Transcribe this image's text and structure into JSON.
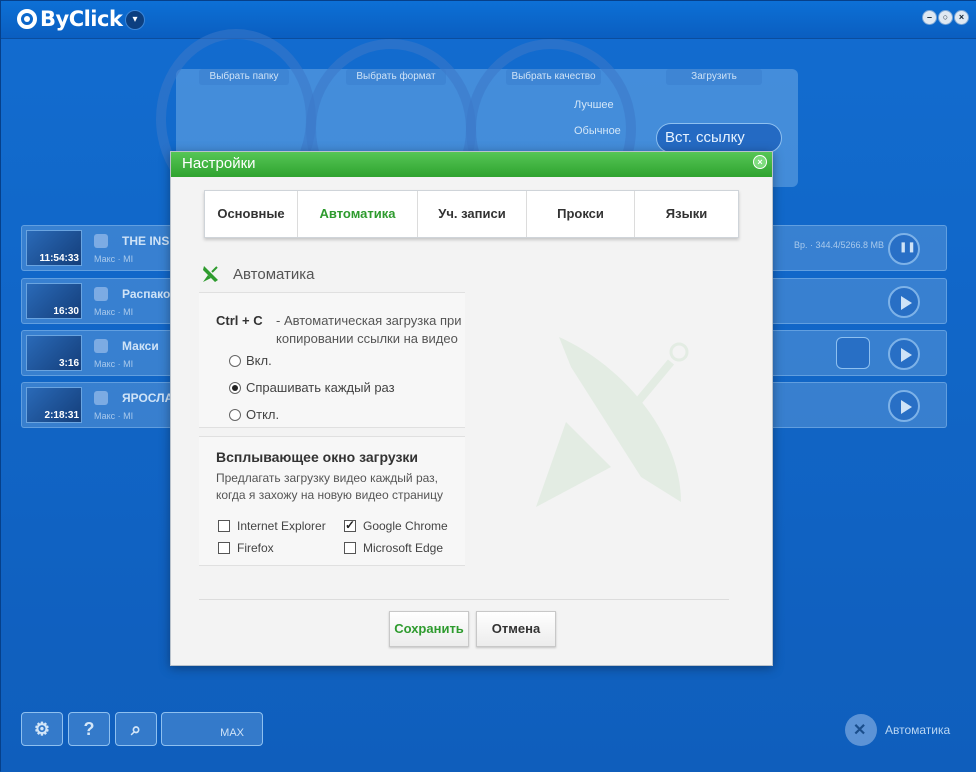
{
  "app": {
    "name": "ByClick",
    "menu_glyph": "▾",
    "min_glyph": "–",
    "restore_glyph": "○",
    "close_glyph": "×"
  },
  "wheel": {
    "choose_folder": "Выбрать папку",
    "choose_format": "Выбрать формат",
    "choose_quality": "Выбрать качество",
    "download": "Загрузить",
    "quality_best": "Лучшее",
    "quality_normal": "Обычное",
    "paste_link": "Вст. ссылку"
  },
  "downloads": [
    {
      "title": "THE INS",
      "duration": "11:54:33",
      "sub": "Макс · MI",
      "info": "Вр. · 344.4/5266.8 MB",
      "state": "pause"
    },
    {
      "title": "Распако",
      "duration": "16:30",
      "sub": "Макс · MI",
      "info": "",
      "state": "play"
    },
    {
      "title": "Макси",
      "duration": "3:16",
      "sub": "Макс · MI",
      "info": "",
      "state": "play"
    },
    {
      "title": "ЯРОСЛА",
      "duration": "2:18:31",
      "sub": "Макс · MI",
      "info": "",
      "state": "play"
    }
  ],
  "bottom": {
    "settings_glyph": "⚙",
    "help_glyph": "?",
    "search_glyph": "⌕",
    "speed_label": "MAX",
    "auto_label": "Автоматика"
  },
  "dialog": {
    "title": "Настройки",
    "close_glyph": "×",
    "tabs": [
      "Основные",
      "Автоматика",
      "Уч. записи",
      "Прокси",
      "Языки"
    ],
    "active_tab": 1,
    "section_title": "Автоматика",
    "hotkey": "Ctrl + C",
    "hotkey_desc_1": "- Автоматическая загрузка при",
    "hotkey_desc_2": "копировании ссылки на видео",
    "radio_options": [
      {
        "label": "Вкл.",
        "checked": false
      },
      {
        "label": "Спрашивать каждый раз",
        "checked": true
      },
      {
        "label": "Откл.",
        "checked": false
      }
    ],
    "popup_title": "Всплывающее окно загрузки",
    "popup_desc_1": "Предлагать загрузку видео каждый раз,",
    "popup_desc_2": "когда я захожу на новую видео страницу",
    "browsers": [
      {
        "label": "Internet Explorer",
        "checked": false
      },
      {
        "label": "Google Chrome",
        "checked": true
      },
      {
        "label": "Firefox",
        "checked": false
      },
      {
        "label": "Microsoft Edge",
        "checked": false
      }
    ],
    "save_label": "Сохранить",
    "cancel_label": "Отмена",
    "accent": "#2e9b2e"
  }
}
